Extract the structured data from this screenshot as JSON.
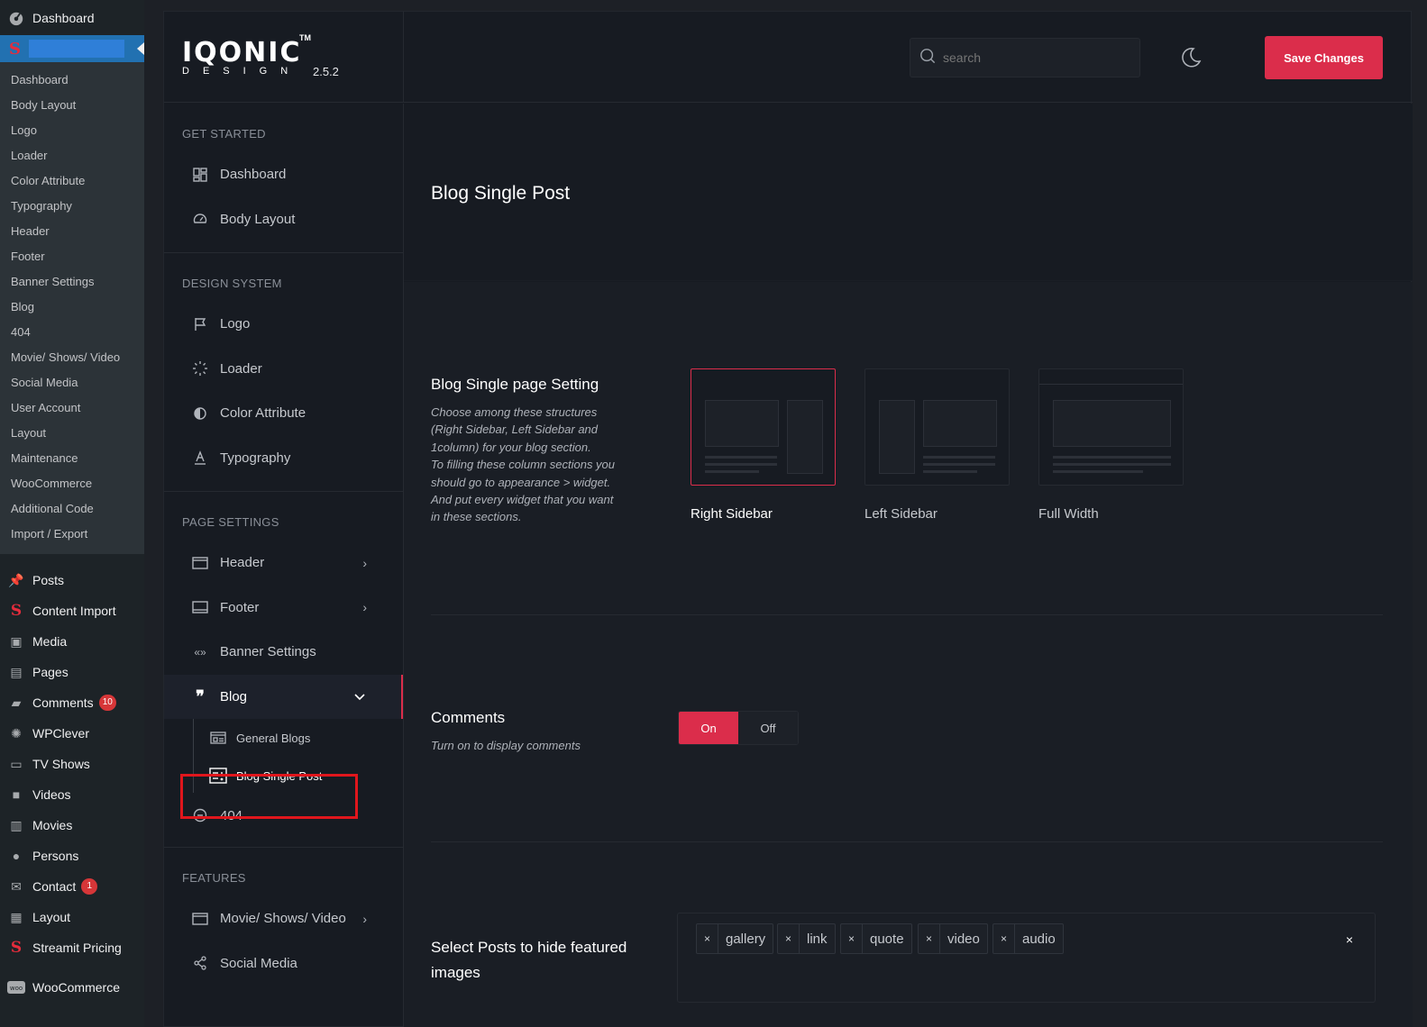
{
  "wp_menu": {
    "top_item": "Dashboard",
    "sub_items": [
      "Dashboard",
      "Body Layout",
      "Logo",
      "Loader",
      "Color Attribute",
      "Typography",
      "Header",
      "Footer",
      "Banner Settings",
      "Blog",
      "404",
      "Movie/ Shows/ Video",
      "Social Media",
      "User Account",
      "Layout",
      "Maintenance",
      "WooCommerce",
      "Additional Code",
      "Import / Export"
    ],
    "items": [
      {
        "label": "Posts",
        "icon": "pin-icon"
      },
      {
        "label": "Content Import",
        "icon": "streamit-s-icon"
      },
      {
        "label": "Media",
        "icon": "media-icon"
      },
      {
        "label": "Pages",
        "icon": "pages-icon"
      },
      {
        "label": "Comments",
        "icon": "comment-icon",
        "badge": "10"
      },
      {
        "label": "WPClever",
        "icon": "bulb-icon"
      },
      {
        "label": "TV Shows",
        "icon": "tv-icon"
      },
      {
        "label": "Videos",
        "icon": "video-camera-icon"
      },
      {
        "label": "Movies",
        "icon": "film-icon"
      },
      {
        "label": "Persons",
        "icon": "person-icon"
      },
      {
        "label": "Contact",
        "icon": "mail-icon",
        "badge": "1"
      },
      {
        "label": "Layout",
        "icon": "grid-icon"
      },
      {
        "label": "Streamit Pricing",
        "icon": "streamit-s-icon"
      },
      {
        "label": "WooCommerce",
        "icon": "woo-icon"
      }
    ]
  },
  "header": {
    "logo_word": "IQONIC",
    "logo_tm": "TM",
    "logo_sub": "DESIGN",
    "version": "2.5.2",
    "search_placeholder": "search",
    "save_label": "Save Changes"
  },
  "theme_nav": {
    "sections": [
      {
        "heading": "GET STARTED",
        "items": [
          {
            "label": "Dashboard",
            "icon": "dashboard-icon"
          },
          {
            "label": "Body Layout",
            "icon": "gauge-icon"
          }
        ]
      },
      {
        "heading": "DESIGN SYSTEM",
        "items": [
          {
            "label": "Logo",
            "icon": "flag-icon"
          },
          {
            "label": "Loader",
            "icon": "loader-icon"
          },
          {
            "label": "Color Attribute",
            "icon": "contrast-icon"
          },
          {
            "label": "Typography",
            "icon": "typography-icon"
          }
        ]
      },
      {
        "heading": "PAGE SETTINGS",
        "items": [
          {
            "label": "Header",
            "icon": "header-icon"
          },
          {
            "label": "Footer",
            "icon": "footer-icon"
          },
          {
            "label": "Banner Settings",
            "icon": "banner-icon"
          },
          {
            "label": "Blog",
            "icon": "quote-icon"
          },
          {
            "label": "General Blogs",
            "icon": "general-blogs-icon"
          },
          {
            "label": "Blog Single Post",
            "icon": "single-post-icon"
          },
          {
            "label": "404",
            "icon": "minus-circle-icon"
          }
        ]
      },
      {
        "heading": "FEATURES",
        "items": [
          {
            "label": "Movie/ Shows/ Video",
            "icon": "window-icon"
          },
          {
            "label": "Social Media",
            "icon": "share-icon"
          }
        ]
      }
    ]
  },
  "content": {
    "page_title": "Blog Single Post",
    "layout_setting": {
      "title": "Blog Single page Setting",
      "description": [
        "Choose among these structures",
        "(Right Sidebar, Left Sidebar and",
        "1column) for your blog section.",
        "To filling these column sections you",
        "should go to appearance > widget.",
        "And put every widget that you want",
        "in these sections."
      ],
      "options": [
        {
          "label": "Right Sidebar",
          "selected": true
        },
        {
          "label": "Left Sidebar",
          "selected": false
        },
        {
          "label": "Full Width",
          "selected": false
        }
      ]
    },
    "comments": {
      "title": "Comments",
      "description": "Turn on to display comments",
      "on_label": "On",
      "off_label": "Off",
      "value": "On"
    },
    "hide_featured": {
      "title_line1": "Select Posts to hide featured",
      "title_line2": "images",
      "tags": [
        "gallery",
        "link",
        "quote",
        "video",
        "audio"
      ],
      "remove_glyph": "×"
    }
  },
  "colors": {
    "accent": "#db2d4b",
    "panel_bg": "#171b22",
    "wp_sidebar": "#1d2327",
    "wp_active": "#2271b1"
  }
}
